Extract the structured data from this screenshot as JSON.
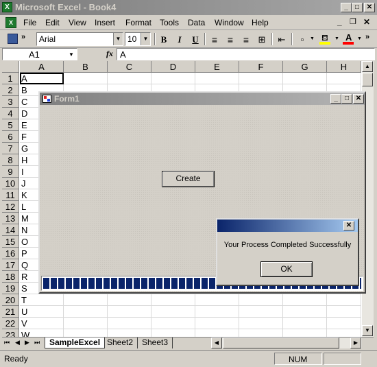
{
  "app": {
    "title": "Microsoft Excel - Book4",
    "logo_letter": "X"
  },
  "menu": [
    {
      "label": "File"
    },
    {
      "label": "Edit"
    },
    {
      "label": "View"
    },
    {
      "label": "Insert"
    },
    {
      "label": "Format"
    },
    {
      "label": "Tools"
    },
    {
      "label": "Data"
    },
    {
      "label": "Window"
    },
    {
      "label": "Help"
    }
  ],
  "toolbar": {
    "font_name": "Arial",
    "font_size": "10",
    "bold": "B",
    "italic": "I",
    "underline": "U"
  },
  "formula_bar": {
    "name_box": "A1",
    "fx_label": "fx",
    "value": "A"
  },
  "grid": {
    "columns": [
      "A",
      "B",
      "C",
      "D",
      "E",
      "F",
      "G",
      "H"
    ],
    "rows": [
      "1",
      "2",
      "3",
      "4",
      "5",
      "6",
      "7",
      "8",
      "9",
      "10",
      "11",
      "12",
      "13",
      "14",
      "15",
      "16",
      "17",
      "18",
      "19",
      "20",
      "21",
      "22",
      "23"
    ],
    "col_a_values": [
      "A",
      "B",
      "C",
      "D",
      "E",
      "F",
      "G",
      "H",
      "I",
      "J",
      "K",
      "L",
      "M",
      "N",
      "O",
      "P",
      "Q",
      "R",
      "S",
      "T",
      "U",
      "V",
      "W"
    ]
  },
  "sheet_tabs": [
    "SampleExcel",
    "Sheet2",
    "Sheet3"
  ],
  "active_tab": "SampleExcel",
  "status": {
    "left": "Ready",
    "num": "NUM"
  },
  "form1": {
    "title": "Form1",
    "create_button": "Create",
    "progress": 1.0
  },
  "message_box": {
    "text": "Your Process Completed Successfully",
    "ok_button": "OK"
  },
  "colors": {
    "progress_fill": "#0a246a",
    "active_caption": "#0a246a",
    "inactive_caption": "#808080"
  }
}
